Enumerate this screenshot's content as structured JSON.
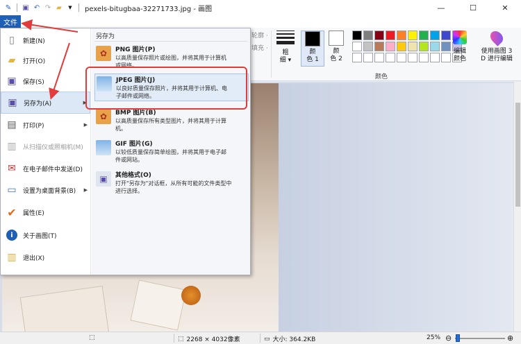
{
  "window": {
    "title": "pexels-bitugbaa-32271733.jpg - 画图",
    "minimize": "—",
    "maximize": "☐",
    "close": "✕"
  },
  "tabs": {
    "file_label": "文件"
  },
  "ribbon": {
    "ghost_outline": "轮廓 ·",
    "ghost_fill": "填充 ·",
    "thickness_label": "粗\n细",
    "color1_label": "颜\n色 1",
    "color2_label": "颜\n色 2",
    "palette_group_label": "颜色",
    "edit_colors_label": "编辑\n颜色",
    "paint3d_label": "使用画图 3\nD 进行编辑",
    "palette_colors": [
      "#000000",
      "#7f7f7f",
      "#880015",
      "#ed1c24",
      "#ff7f27",
      "#fff200",
      "#22b14c",
      "#00a2e8",
      "#3f48cc",
      "#a349a4",
      "#ffffff",
      "#c3c3c3",
      "#b97a57",
      "#ffaec9",
      "#ffc90e",
      "#efe4b0",
      "#b5e61d",
      "#99d9ea",
      "#7092be",
      "#c8bfe7",
      "#ffffff",
      "#ffffff",
      "#ffffff",
      "#ffffff",
      "#ffffff",
      "#ffffff",
      "#ffffff",
      "#ffffff",
      "#ffffff",
      "#ffffff"
    ],
    "color1": "#000000",
    "color2": "#ffffff"
  },
  "file_menu": {
    "items": [
      {
        "label": "新建(N)",
        "icon": "new-file-icon"
      },
      {
        "label": "打开(O)",
        "icon": "open-folder-icon"
      },
      {
        "label": "保存(S)",
        "icon": "save-icon"
      },
      {
        "label": "另存为(A)",
        "icon": "save-as-icon"
      },
      {
        "label": "打印(P)",
        "icon": "printer-icon"
      },
      {
        "label": "从扫描仪或照相机(M)",
        "icon": "scanner-icon"
      },
      {
        "label": "在电子邮件中发送(D)",
        "icon": "email-icon"
      },
      {
        "label": "设置为桌面背景(B)",
        "icon": "desktop-icon"
      },
      {
        "label": "属性(E)",
        "icon": "properties-check-icon"
      },
      {
        "label": "关于画图(T)",
        "icon": "info-icon"
      },
      {
        "label": "退出(X)",
        "icon": "exit-icon"
      }
    ],
    "save_as_heading": "另存为",
    "save_as_options": [
      {
        "title": "PNG 图片(P)",
        "desc1": "以高质量保存照片或绘图，并将其用于计算机",
        "desc2": "或网络。"
      },
      {
        "title": "JPEG 图片(J)",
        "desc1": "以良好质量保存照片，并将其用于计算机、电",
        "desc2": "子邮件或网络。"
      },
      {
        "title": "BMP 图片(B)",
        "desc1": "以高质量保存所有类型图片，并将其用于计算",
        "desc2": "机。"
      },
      {
        "title": "GIF 图片(G)",
        "desc1": "以较低质量保存简单绘图，并将其用于电子邮",
        "desc2": "件或网站。"
      },
      {
        "title": "其他格式(O)",
        "desc1": "打开\"另存为\"对话框，从所有可能的文件类型中",
        "desc2": "进行选择。"
      }
    ]
  },
  "status": {
    "dimensions": "2268 × 4032像素",
    "size": "大小: 364.2KB",
    "zoom": "25%",
    "zoom_minus": "⊖",
    "zoom_plus": "⊕",
    "zoom_fraction": 0.05
  }
}
